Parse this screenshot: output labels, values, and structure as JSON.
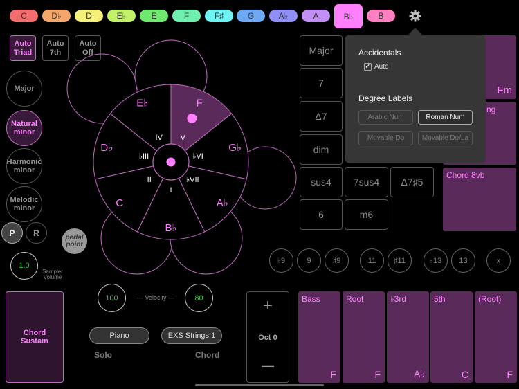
{
  "keys": [
    {
      "label": "C",
      "color": "#f26d6d"
    },
    {
      "label": "D♭",
      "color": "#f5a66b"
    },
    {
      "label": "D",
      "color": "#f5f07a"
    },
    {
      "label": "E♭",
      "color": "#c2f26a"
    },
    {
      "label": "E",
      "color": "#6fe86f"
    },
    {
      "label": "F",
      "color": "#6ff0b0"
    },
    {
      "label": "F♯",
      "color": "#6ff2f2"
    },
    {
      "label": "G",
      "color": "#6fa8f2"
    },
    {
      "label": "A♭",
      "color": "#8f8ff5"
    },
    {
      "label": "A",
      "color": "#c28ff5"
    },
    {
      "label": "B♭",
      "color": "#ff80ff",
      "selected": true
    },
    {
      "label": "B",
      "color": "#ff80c0"
    }
  ],
  "settings_icon": "gear-icon",
  "auto_modes": [
    {
      "label": "Auto Triad",
      "active": true
    },
    {
      "label": "Auto 7th"
    },
    {
      "label": "Auto Off"
    }
  ],
  "scales": [
    {
      "label": "Major"
    },
    {
      "label": "Natural minor",
      "active": true
    },
    {
      "label": "Harmonic minor"
    },
    {
      "label": "Melodic minor"
    }
  ],
  "pr": {
    "p": "P",
    "r": "R"
  },
  "pedal_point": "pedal point",
  "sampler": {
    "value": "1.0",
    "label": "Sampler Volume"
  },
  "wheel": {
    "segments": [
      {
        "note": "F",
        "degree": "V",
        "active": true
      },
      {
        "note": "G♭",
        "degree": "♭VI"
      },
      {
        "note": "A♭",
        "degree": "♭VII"
      },
      {
        "note": "B♭",
        "degree": "I"
      },
      {
        "note": "C",
        "degree": "II"
      },
      {
        "note": "D♭",
        "degree": "♭III"
      },
      {
        "note": "E♭",
        "degree": "IV"
      }
    ],
    "accent": "#c06cc0",
    "active_fill": "#5a2a5a",
    "dot": "#ff80ff"
  },
  "chord_types": {
    "col1": [
      "Major",
      "7",
      "Δ7",
      "dim",
      "sus4",
      "6"
    ],
    "row5": [
      "7sus4",
      "Δ7♯5"
    ],
    "row6": [
      "m6"
    ]
  },
  "pads": {
    "chord": "Fm",
    "second": "ng",
    "octave_down": "Chord 8vb"
  },
  "popover": {
    "accidentals_title": "Accidentals",
    "auto_label": "Auto",
    "auto_checked": true,
    "degree_title": "Degree Labels",
    "options": [
      {
        "label": "Arabic Num"
      },
      {
        "label": "Roman Num",
        "active": true
      },
      {
        "label": "Movable Do"
      },
      {
        "label": "Movable Do/La"
      }
    ]
  },
  "extensions": [
    "♭9",
    "9",
    "♯9",
    "11",
    "♯11",
    "♭13",
    "13",
    "x"
  ],
  "chord_sustain": "Chord Sustain",
  "velocity": {
    "label": "Velocity",
    "solo": "100",
    "chord": "80"
  },
  "instruments": {
    "solo": "Piano",
    "chord": "EXS Strings 1",
    "solo_label": "Solo",
    "chord_label": "Chord"
  },
  "octave": {
    "plus": "+",
    "label": "Oct 0",
    "minus": "—"
  },
  "voices": [
    {
      "role": "Bass",
      "note": "F"
    },
    {
      "role": "Root",
      "note": "F"
    },
    {
      "role": "♭3rd",
      "note": "A♭"
    },
    {
      "role": "5th",
      "note": "C"
    },
    {
      "role": "(Root)",
      "note": "F"
    }
  ]
}
